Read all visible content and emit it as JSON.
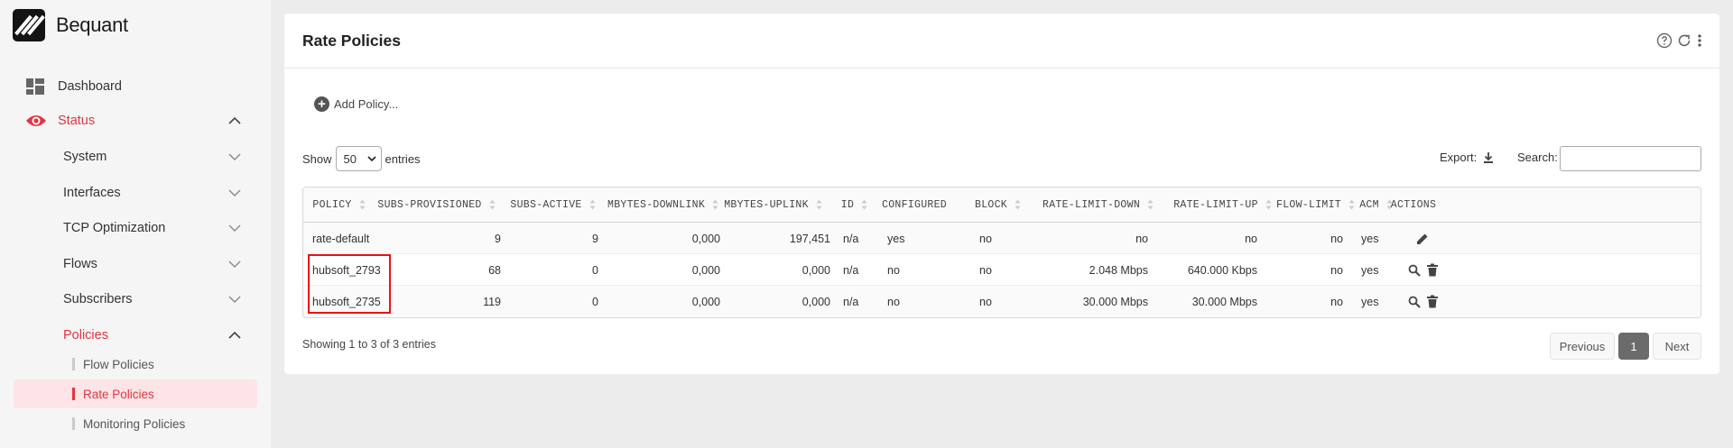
{
  "brand": {
    "name": "Bequant"
  },
  "sidebar": {
    "dashboard": "Dashboard",
    "status": "Status",
    "items": [
      {
        "label": "System"
      },
      {
        "label": "Interfaces"
      },
      {
        "label": "TCP Optimization"
      },
      {
        "label": "Flows"
      },
      {
        "label": "Subscribers"
      },
      {
        "label": "Policies"
      }
    ],
    "sub_items": [
      {
        "label": "Flow Policies"
      },
      {
        "label": "Rate Policies"
      },
      {
        "label": "Monitoring Policies"
      }
    ]
  },
  "card": {
    "title": "Rate Policies",
    "add_policy": "Add Policy...",
    "show": "Show",
    "entries_value": "50",
    "entries": "entries",
    "export": "Export:",
    "search": "Search:",
    "showing": "Showing 1 to 3 of 3 entries"
  },
  "table": {
    "headers": [
      "POLICY",
      "SUBS-PROVISIONED",
      "SUBS-ACTIVE",
      "MBYTES-DOWNLINK",
      "MBYTES-UPLINK",
      "ID",
      "CONFIGURED",
      "BLOCK",
      "RATE-LIMIT-DOWN",
      "RATE-LIMIT-UP",
      "FLOW-LIMIT",
      "ACM",
      "ACTIONS"
    ],
    "rows": [
      [
        "rate-default",
        "9",
        "9",
        "0,000",
        "197,451",
        "n/a",
        "yes",
        "no",
        "no",
        "no",
        "no",
        "yes"
      ],
      [
        "hubsoft_2793",
        "68",
        "0",
        "0,000",
        "0,000",
        "n/a",
        "no",
        "no",
        "2.048 Mbps",
        "640.000 Kbps",
        "no",
        "yes"
      ],
      [
        "hubsoft_2735",
        "119",
        "0",
        "0,000",
        "0,000",
        "n/a",
        "no",
        "no",
        "30.000 Mbps",
        "30.000 Mbps",
        "no",
        "yes"
      ]
    ]
  },
  "pager": {
    "previous": "Previous",
    "page": "1",
    "next": "Next"
  },
  "colors": {
    "accent": "#e3343f",
    "highlight": "#ee1111"
  }
}
